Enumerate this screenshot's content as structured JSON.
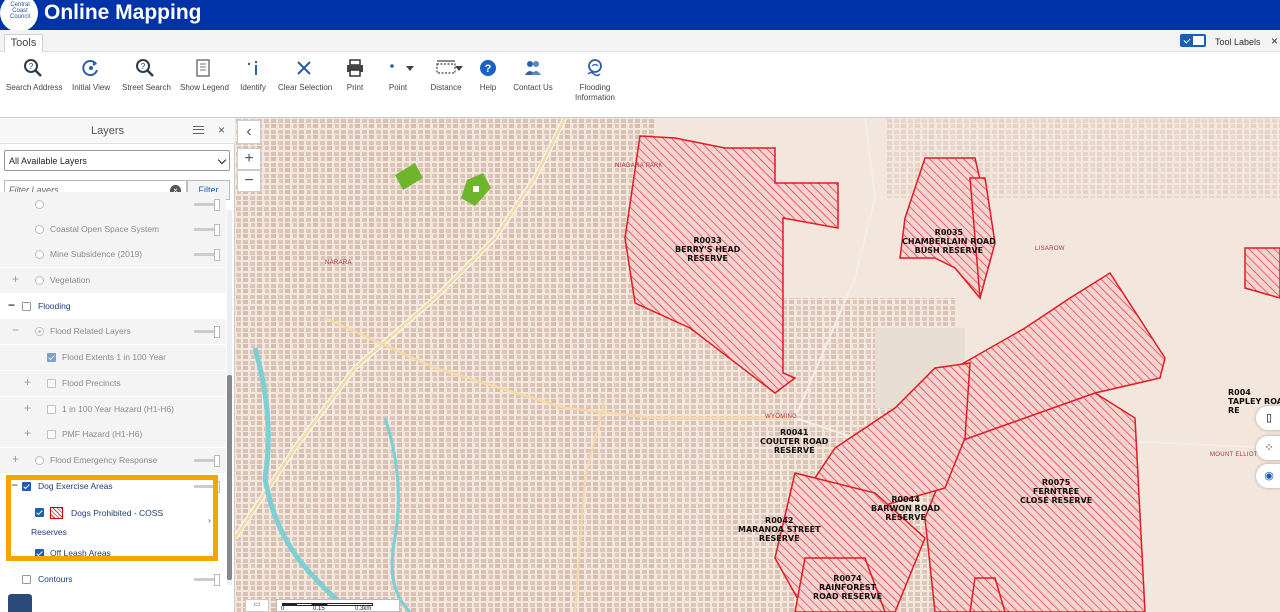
{
  "header": {
    "logo_lines": [
      "Central",
      "Coast",
      "Council"
    ],
    "title": "Online Mapping"
  },
  "tabs": {
    "tools": "Tools",
    "tool_labels": "Tool Labels",
    "close": "×"
  },
  "toolbar": {
    "search_address": "Search Address",
    "initial_view": "Initial View",
    "street_search": "Street Search",
    "show_legend": "Show Legend",
    "identify": "Identify",
    "clear_selection": "Clear Selection",
    "print": "Print",
    "point": "Point",
    "distance": "Distance",
    "help": "Help",
    "contact_us": "Contact Us",
    "flooding_line1": "Flooding",
    "flooding_line2": "Information"
  },
  "layers": {
    "title": "Layers",
    "close": "×",
    "select_value": "All Available Layers",
    "filter_placeholder": "Filter Layers...",
    "filter_button": "Filter",
    "items": {
      "coastal": "Coastal Open Space System",
      "mine": "Mine Subsidence (2019)",
      "vegetation": "Vegetation",
      "flooding": "Flooding",
      "flood_related": "Flood Related Layers",
      "flood_extents": "Flood Extents 1 in 100 Year",
      "flood_precincts": "Flood Precincts",
      "hazard": "1 in 100 Year Hazard (H1-H6)",
      "pmf": "PMF Hazard (H1-H6)",
      "emergency": "Flood Emergency Response",
      "dog_exercise": "Dog Exercise Areas",
      "dogs_prohibited_1": "Dogs Prohibited - COSS",
      "dogs_prohibited_2": "Reserves",
      "off_leash": "Off Leash Areas",
      "contours": "Contours"
    }
  },
  "map": {
    "zoom_in": "+",
    "zoom_out": "−",
    "collapse": "‹",
    "suburbs": {
      "niagara_park": "NIAGARA PARK",
      "narara": "NARARA",
      "lisarow": "LISAROW",
      "wyoming": "WYOMING",
      "mount_elliot": "MOUNT ELLIOT"
    },
    "reserves": {
      "r0033": "R0033\nBERRY'S HEAD\nRESERVE",
      "r0035": "R0035\nCHAMBERLAIN ROAD\nBUSH RESERVE",
      "r0041": "R0041\nCOULTER ROAD\nRESERVE",
      "r0044": "R0044\nBARWON ROAD\nRESERVE",
      "r0075": "R0075\nFERNTREE\nCLOSE RESERVE",
      "r0042": "R0042\nMARANOA STREET\nRESERVE",
      "r0074": "R0074\nRAINFOREST\nROAD RESERVE",
      "r004x": "R004\nTAPLEY ROA\nRE"
    },
    "scale": {
      "zero": "0",
      "mid": "0.15",
      "end": "0.3km"
    }
  },
  "colors": {
    "header": "#0033a8",
    "highlight": "#f5a400",
    "reserve": "#e01c24",
    "offleash": "#6fb52c"
  }
}
